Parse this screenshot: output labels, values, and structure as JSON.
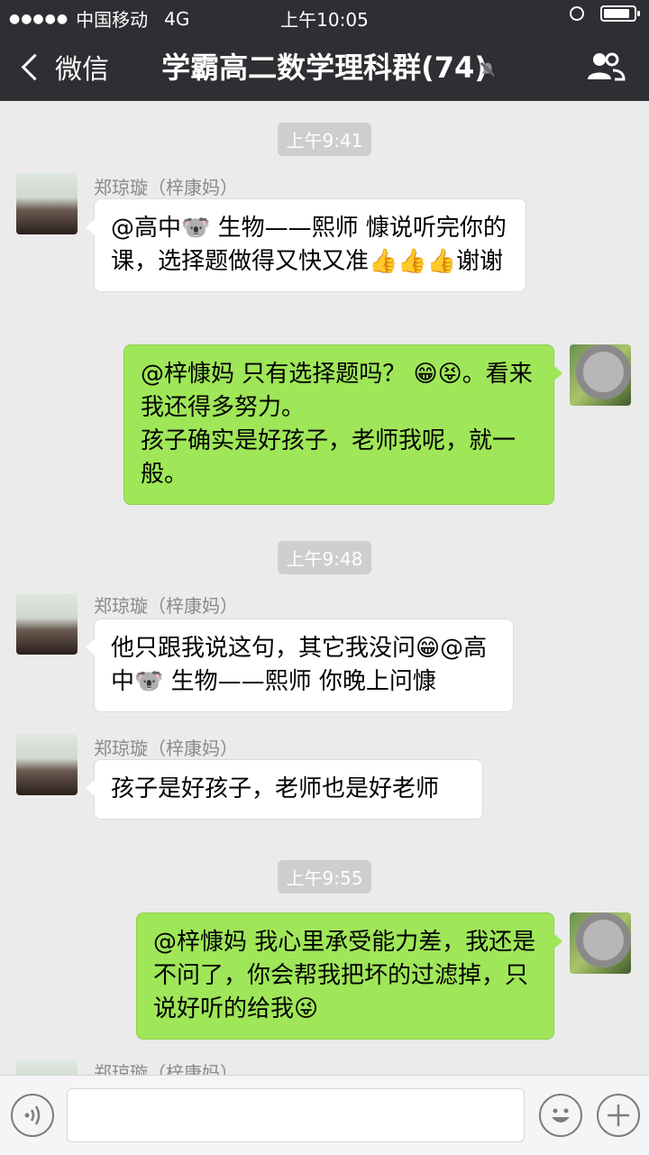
{
  "status_bar": {
    "signal_dots": "●●●●●",
    "carrier": "中国移动",
    "network": "4G",
    "time": "上午10:05"
  },
  "nav": {
    "back_label": "微信",
    "title": "学霸高二数学理科群(74)"
  },
  "messages": [
    {
      "type": "timestamp",
      "text": "上午9:41"
    },
    {
      "type": "incoming",
      "sender": "郑琼璇（梓康妈）",
      "text": "@高中🐨 生物——熙师 慷说听完你的课，选择题做得又快又准👍👍👍谢谢"
    },
    {
      "type": "outgoing",
      "text": "@梓慷妈 只有选择题吗？ 😁😝。看来我还得多努力。\n孩子确实是好孩子，老师我呢，就一般。"
    },
    {
      "type": "timestamp",
      "text": "上午9:48"
    },
    {
      "type": "incoming",
      "sender": "郑琼璇（梓康妈）",
      "text": "他只跟我说这句，其它我没问😁@高中🐨 生物——熙师 你晚上问慷"
    },
    {
      "type": "incoming",
      "sender": "郑琼璇（梓康妈）",
      "text": "孩子是好孩子，老师也是好老师"
    },
    {
      "type": "timestamp",
      "text": "上午9:55"
    },
    {
      "type": "outgoing",
      "text": "@梓慷妈 我心里承受能力差，我还是不问了，你会帮我把坏的过滤掉，只说好听的给我😜"
    },
    {
      "type": "incoming_partial",
      "sender": "郑琼璇（梓康妈）"
    }
  ],
  "colors": {
    "nav_bg": "#2e2e33",
    "chat_bg": "#ebebeb",
    "outgoing_bubble": "#9fe658",
    "incoming_bubble": "#ffffff"
  },
  "icons": [
    "back-chevron-icon",
    "mute-icon",
    "group-members-icon",
    "voice-icon",
    "emoji-icon",
    "plus-icon"
  ]
}
